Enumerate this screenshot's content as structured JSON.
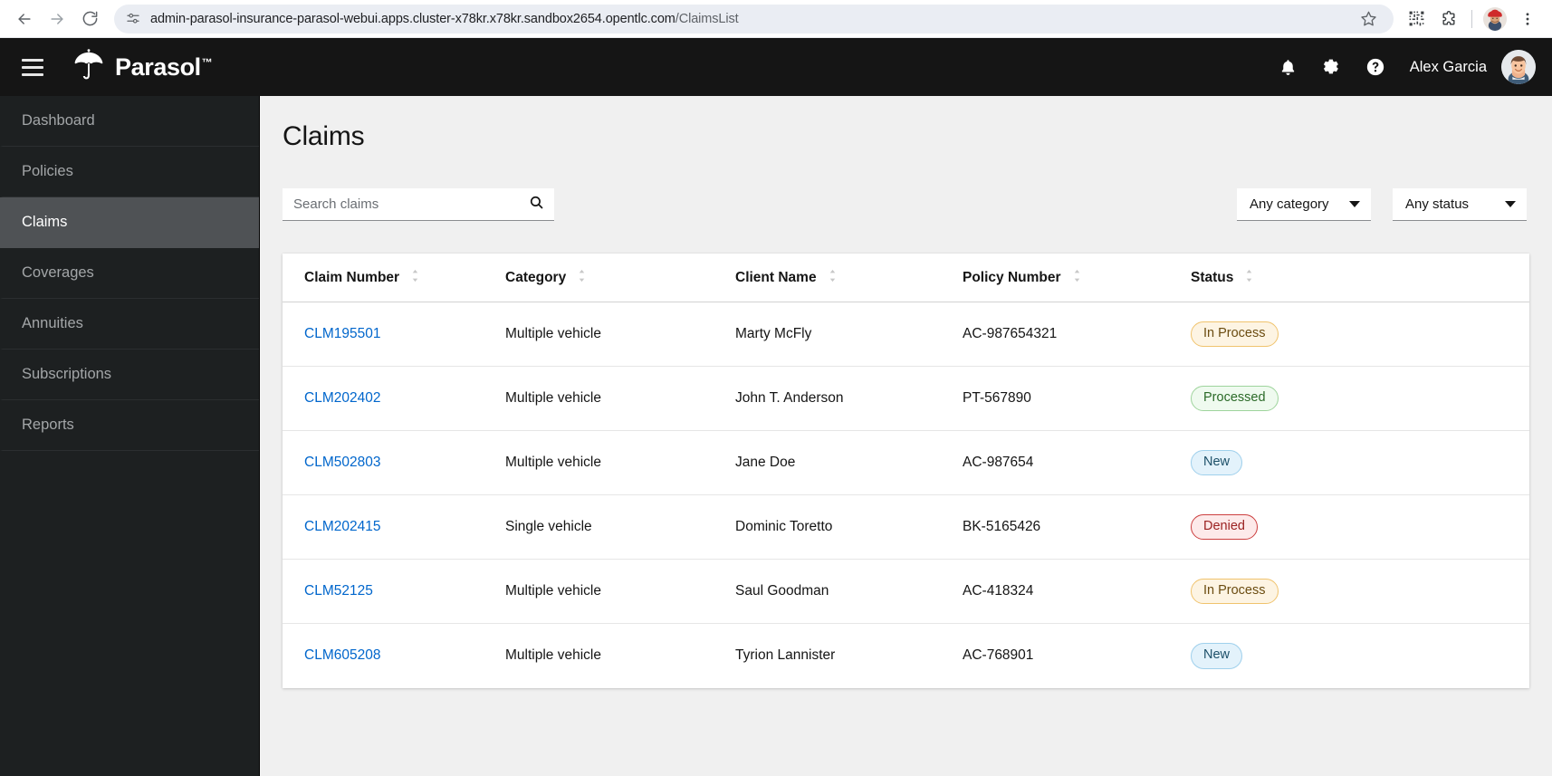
{
  "browser": {
    "back_icon": "back-arrow-icon",
    "forward_icon": "forward-arrow-icon",
    "reload_icon": "reload-icon",
    "site_info_icon": "site-settings-icon",
    "url_host": "admin-parasol-insurance-parasol-webui.apps.cluster-x78kr.x78kr.sandbox2654.opentlc.com",
    "url_path": "/ClaimsList",
    "bookmark_icon": "star-icon",
    "qr_icon": "qr-code-icon",
    "extensions_icon": "puzzle-extensions-icon",
    "profile_icon": "profile-avatar-icon",
    "menu_icon": "three-dot-menu-icon"
  },
  "header": {
    "menu_icon": "hamburger-menu-icon",
    "logo_icon": "umbrella-logo-icon",
    "brand": "Parasol",
    "brand_tm": "™",
    "notifications_icon": "bell-icon",
    "settings_icon": "gear-icon",
    "help_icon": "help-circle-icon",
    "user_name": "Alex Garcia",
    "avatar_icon": "user-avatar-icon"
  },
  "sidebar": {
    "items": [
      {
        "label": "Dashboard",
        "active": false
      },
      {
        "label": "Policies",
        "active": false
      },
      {
        "label": "Claims",
        "active": true
      },
      {
        "label": "Coverages",
        "active": false
      },
      {
        "label": "Annuities",
        "active": false
      },
      {
        "label": "Subscriptions",
        "active": false
      },
      {
        "label": "Reports",
        "active": false
      }
    ]
  },
  "main": {
    "page_title": "Claims",
    "search": {
      "placeholder": "Search claims",
      "value": "",
      "icon": "search-icon"
    },
    "filters": [
      {
        "label": "Any category",
        "icon": "chevron-down-icon"
      },
      {
        "label": "Any status",
        "icon": "chevron-down-icon"
      }
    ],
    "table": {
      "columns": [
        {
          "label": "Claim Number",
          "sortable": true
        },
        {
          "label": "Category",
          "sortable": true
        },
        {
          "label": "Client Name",
          "sortable": true
        },
        {
          "label": "Policy Number",
          "sortable": true
        },
        {
          "label": "Status",
          "sortable": true
        }
      ],
      "rows": [
        {
          "claim_number": "CLM195501",
          "category": "Multiple vehicle",
          "client_name": "Marty McFly",
          "policy_number": "AC-987654321",
          "status": "In Process",
          "status_key": "inprocess"
        },
        {
          "claim_number": "CLM202402",
          "category": "Multiple vehicle",
          "client_name": "John T. Anderson",
          "policy_number": "PT-567890",
          "status": "Processed",
          "status_key": "processed"
        },
        {
          "claim_number": "CLM502803",
          "category": "Multiple vehicle",
          "client_name": "Jane Doe",
          "policy_number": "AC-987654",
          "status": "New",
          "status_key": "new"
        },
        {
          "claim_number": "CLM202415",
          "category": "Single vehicle",
          "client_name": "Dominic Toretto",
          "policy_number": "BK-5165426",
          "status": "Denied",
          "status_key": "denied"
        },
        {
          "claim_number": "CLM52125",
          "category": "Multiple vehicle",
          "client_name": "Saul Goodman",
          "policy_number": "AC-418324",
          "status": "In Process",
          "status_key": "inprocess"
        },
        {
          "claim_number": "CLM605208",
          "category": "Multiple vehicle",
          "client_name": "Tyrion Lannister",
          "policy_number": "AC-768901",
          "status": "New",
          "status_key": "new"
        }
      ]
    }
  },
  "colors": {
    "header_bg": "#151515",
    "sidebar_bg": "#1d2021",
    "sidebar_active_bg": "#4f5255",
    "link": "#0066cc",
    "page_bg": "#f0f0f0"
  }
}
